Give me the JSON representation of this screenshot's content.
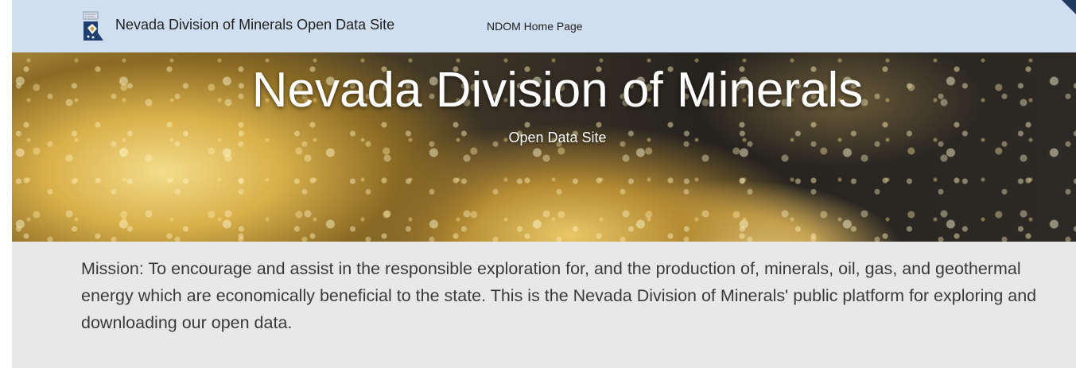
{
  "header": {
    "site_title": "Nevada Division of Minerals Open Data Site",
    "nav_link": "NDOM Home Page",
    "logo_icon": "nevada-state-seal-icon"
  },
  "hero": {
    "title": "Nevada Division of Minerals",
    "subtitle": "Open Data Site"
  },
  "mission": {
    "text": "Mission: To encourage and assist in the responsible exploration for, and the production of, minerals, oil, gas, and geothermal energy which are economically beneficial to the state. This is the Nevada Division of Minerals' public platform for exploring and downloading our open data."
  },
  "colors": {
    "nav_background": "#cfdff0",
    "mission_background": "#e8e8e8",
    "corner_accent": "#1e3a5f"
  }
}
